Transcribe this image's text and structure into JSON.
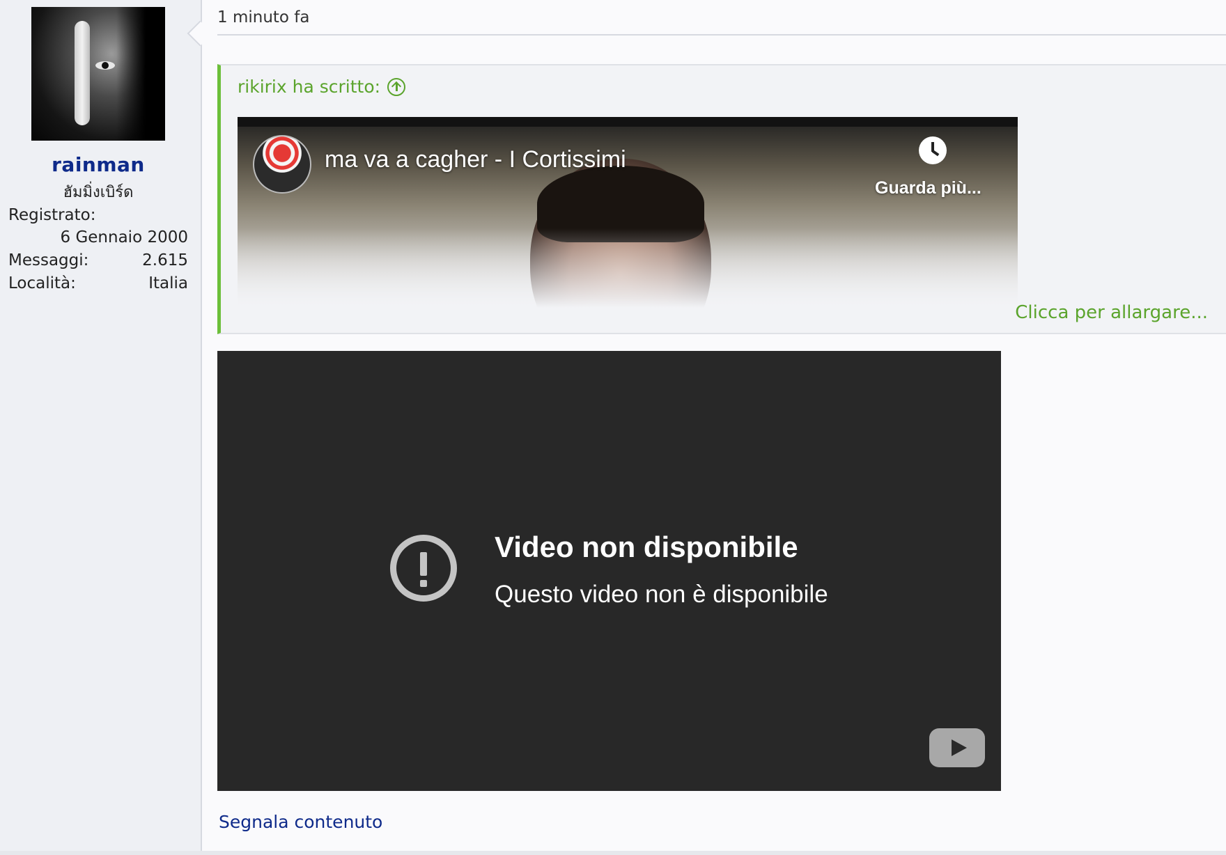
{
  "user": {
    "name": "rainman",
    "title": "ฮัมมิ่งเบิร์ด",
    "stats": [
      {
        "label": "Registrato:",
        "value": "6 Gennaio 2000"
      },
      {
        "label": "Messaggi:",
        "value": "2.615"
      },
      {
        "label": "Località:",
        "value": "Italia"
      }
    ]
  },
  "post": {
    "timestamp": "1 minuto fa",
    "quote": {
      "author_line": "rikirix ha scritto:",
      "video_title": "ma va a cagher - I Cortissimi",
      "watch_later": "Guarda più...",
      "expand_label": "Clicca per allargare..."
    },
    "embed": {
      "title": "Video non disponibile",
      "subtitle": "Questo video non è disponibile"
    },
    "report_label": "Segnala contenuto"
  },
  "colors": {
    "username": "#0e2a8a",
    "quote_accent": "#6cbf3a",
    "quote_text": "#5ba42c",
    "embed_bg": "#282828"
  }
}
